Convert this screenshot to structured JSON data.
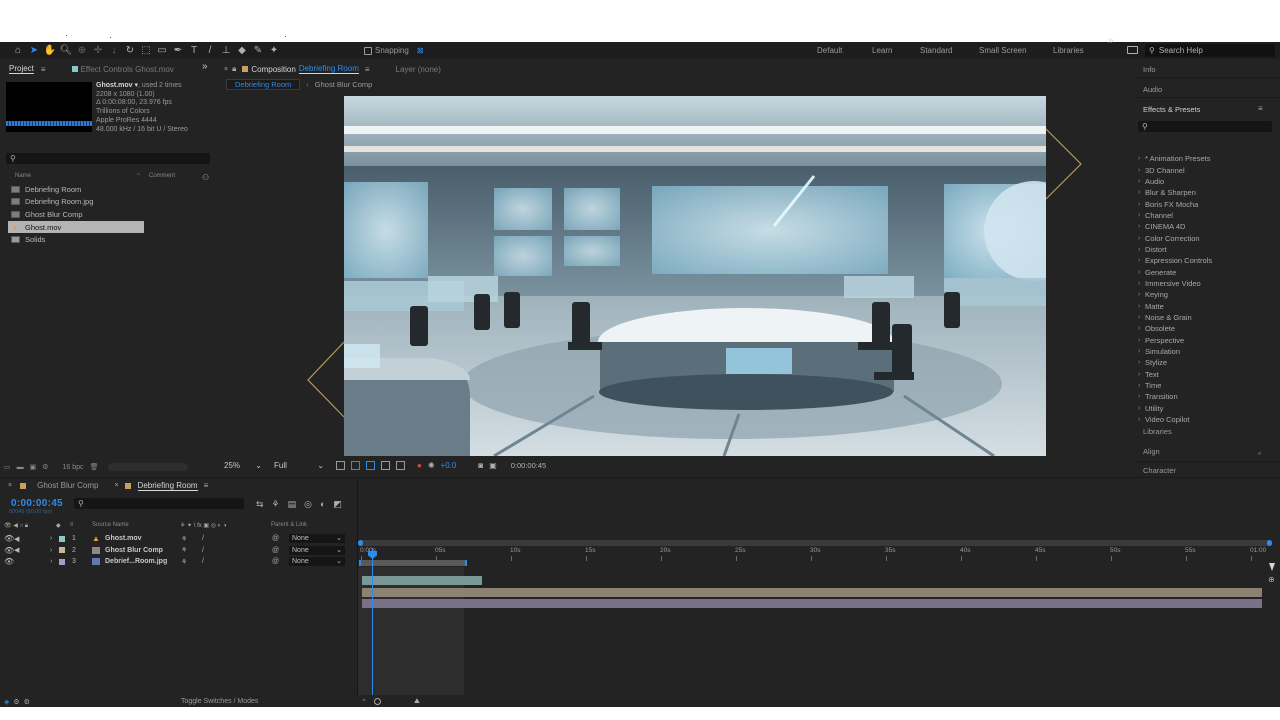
{
  "toolbar": {
    "snapping_label": "Snapping",
    "workspaces": [
      "Default",
      "Learn",
      "Standard",
      "Small Screen",
      "Libraries"
    ],
    "more": "»",
    "search_help_placeholder": "Search Help"
  },
  "project_panel": {
    "tab_project": "Project",
    "tab_effect_controls": "Effect Controls Ghost.mov",
    "selected_name": "Ghost.mov ▾",
    "used": ", used 2 times",
    "info_lines": [
      "2208 x 1080 (1.00)",
      "Δ 0:00:08:00, 23.976 fps",
      "Trillions of Colors",
      "Apple ProRes 4444",
      "48.000 kHz / 16 bit U / Stereo"
    ],
    "search_placeholder": "",
    "col_name": "Name",
    "col_comment": "Comment",
    "items": [
      {
        "name": "Debriefing Room",
        "type": "comp"
      },
      {
        "name": "Debriefing Room.jpg",
        "type": "image"
      },
      {
        "name": "Ghost Blur Comp",
        "type": "comp"
      },
      {
        "name": "Ghost.mov",
        "type": "video"
      },
      {
        "name": "Solids",
        "type": "folder"
      }
    ],
    "bpc": "16 bpc"
  },
  "composition": {
    "tab_label": "Composition",
    "tab_comp_name": "Debriefing Room",
    "layer_label": "Layer (none)",
    "breadcrumb": [
      "Debriefing Room",
      "Ghost Blur Comp"
    ],
    "zoom": "25%",
    "resolution": "Full",
    "exposure": "+0.0",
    "timecode": "0:00:00:45"
  },
  "right_panel": {
    "info": "Info",
    "audio": "Audio",
    "effects_presets": "Effects & Presets",
    "effects": [
      "* Animation Presets",
      "3D Channel",
      "Audio",
      "Blur & Sharpen",
      "Boris FX Mocha",
      "Channel",
      "CINEMA 4D",
      "Color Correction",
      "Distort",
      "Expression Controls",
      "Generate",
      "Immersive Video",
      "Keying",
      "Matte",
      "Noise & Grain",
      "Obsolete",
      "Perspective",
      "Simulation",
      "Stylize",
      "Text",
      "Time",
      "Transition",
      "Utility",
      "Video Copilot"
    ],
    "libraries": "Libraries",
    "align": "Align",
    "character": "Character"
  },
  "timeline": {
    "tab_ghost_blur": "Ghost Blur Comp",
    "tab_debriefing": "Debriefing Room",
    "timecode": "0:00:00:45",
    "fps": "00045 (60.00 fps)",
    "col_source_name": "Source Name",
    "col_parent": "Parent & Link",
    "layers": [
      {
        "num": "1",
        "name": "Ghost.mov",
        "parent": "None",
        "color": "#8cc8c8"
      },
      {
        "num": "2",
        "name": "Ghost Blur Comp",
        "parent": "None",
        "color": "#c8b896"
      },
      {
        "num": "3",
        "name": "Debrief...Room.jpg",
        "parent": "None",
        "color": "#a89ac8"
      }
    ],
    "ruler_ticks": [
      "0:00s",
      "05s",
      "10s",
      "15s",
      "20s",
      "25s",
      "30s",
      "35s",
      "40s",
      "45s",
      "50s",
      "55s",
      "01:00"
    ],
    "toggle_switches": "Toggle Switches / Modes"
  }
}
